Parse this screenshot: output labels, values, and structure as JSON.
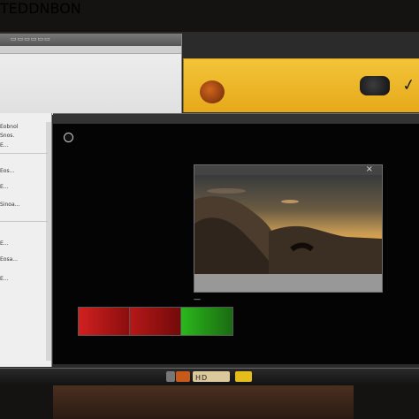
{
  "top_window": {
    "caption": "▭▭▭▭▭▭",
    "heading": "TEDDNBON"
  },
  "sidebar": {
    "rows": [
      "Eobnol",
      "Snos.",
      "E...",
      "Eos...",
      "E...",
      "Sinoa...",
      "E...",
      "Eosa...",
      "E..."
    ]
  },
  "video_panel": {
    "close_symbol": "×",
    "overlay_label": "—"
  },
  "taskbar": {
    "center_label": "HD"
  },
  "colors": {
    "accent": "#f0b72c",
    "screen": "#040404",
    "panel": "#efefef"
  }
}
